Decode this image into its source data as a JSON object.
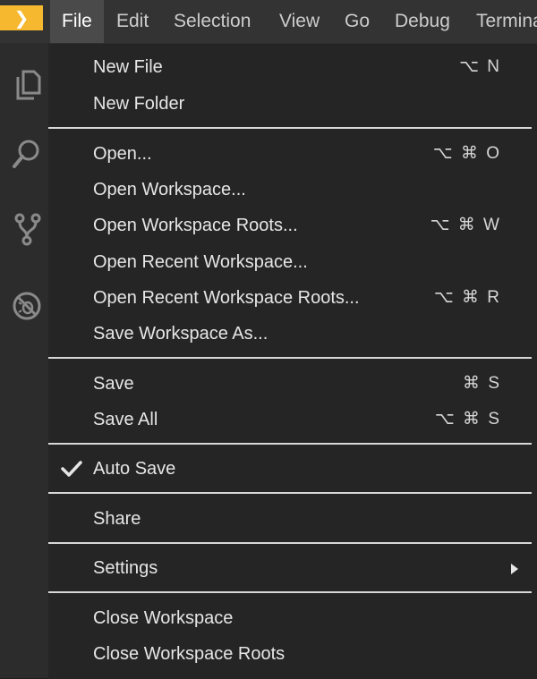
{
  "menubar": {
    "logo_glyph": "❯",
    "items": [
      "File",
      "Edit",
      "Selection",
      "View",
      "Go",
      "Debug",
      "Termina"
    ]
  },
  "activity_bar": {
    "icons": [
      "files-icon",
      "search-icon",
      "source-control-icon",
      "debug-icon"
    ]
  },
  "file_menu": {
    "new_file": {
      "label": "New File",
      "shortcut": "⌥ N"
    },
    "new_folder": {
      "label": "New Folder"
    },
    "open": {
      "label": "Open...",
      "shortcut": "⌥ ⌘ O"
    },
    "open_workspace": {
      "label": "Open Workspace..."
    },
    "open_workspace_roots": {
      "label": "Open Workspace Roots...",
      "shortcut": "⌥ ⌘ W"
    },
    "open_recent_workspace": {
      "label": "Open Recent Workspace..."
    },
    "open_recent_workspace_roots": {
      "label": "Open Recent Workspace Roots...",
      "shortcut": "⌥ ⌘ R"
    },
    "save_workspace_as": {
      "label": "Save Workspace As..."
    },
    "save": {
      "label": "Save",
      "shortcut": "⌘ S"
    },
    "save_all": {
      "label": "Save All",
      "shortcut": "⌥ ⌘ S"
    },
    "auto_save": {
      "label": "Auto Save",
      "checked": true
    },
    "share": {
      "label": "Share"
    },
    "settings": {
      "label": "Settings",
      "has_submenu": true
    },
    "close_workspace": {
      "label": "Close Workspace"
    },
    "close_workspace_roots": {
      "label": "Close Workspace Roots"
    }
  },
  "colors": {
    "accent": "#f5b82e",
    "menu_background": "#252526",
    "menubar_background": "#333333",
    "active_menu": "#4a4a4a",
    "separator": "#d8d8d8",
    "text": "#e6e6e6"
  }
}
